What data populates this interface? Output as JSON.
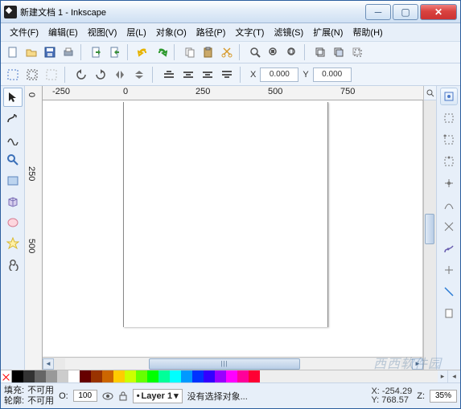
{
  "title": "新建文档 1 - Inkscape",
  "menus": [
    "文件(F)",
    "编辑(E)",
    "视图(V)",
    "层(L)",
    "对象(O)",
    "路径(P)",
    "文字(T)",
    "滤镜(S)",
    "扩展(N)",
    "帮助(H)"
  ],
  "coords": {
    "xlabel": "X",
    "xval": "0.000",
    "ylabel": "Y",
    "yval": "0.000"
  },
  "ruler": {
    "marks": [
      "-250",
      "0",
      "250",
      "500",
      "750"
    ]
  },
  "vruler": {
    "marks": [
      "0",
      "250",
      "500"
    ]
  },
  "palette": [
    "#000000",
    "#333333",
    "#666666",
    "#999999",
    "#cccccc",
    "#ffffff",
    "#660000",
    "#993300",
    "#cc6600",
    "#ffcc00",
    "#ccff00",
    "#66ff00",
    "#00ff00",
    "#00ff99",
    "#00ffff",
    "#0099ff",
    "#0033ff",
    "#3300ff",
    "#9900ff",
    "#ff00ff",
    "#ff0099",
    "#ff0033"
  ],
  "status": {
    "fill_lbl": "填充:",
    "fill_val": "不可用",
    "stroke_lbl": "轮廓:",
    "stroke_val": "不可用",
    "o_lbl": "O:",
    "o_val": "100",
    "layer": "Layer 1",
    "msg": "没有选择对象...",
    "xlbl": "X:",
    "xv": "-254.29",
    "ylbl": "Y:",
    "yv": "768.57",
    "zlbl": "Z:",
    "zv": "35%"
  },
  "watermark": "西西软件园"
}
